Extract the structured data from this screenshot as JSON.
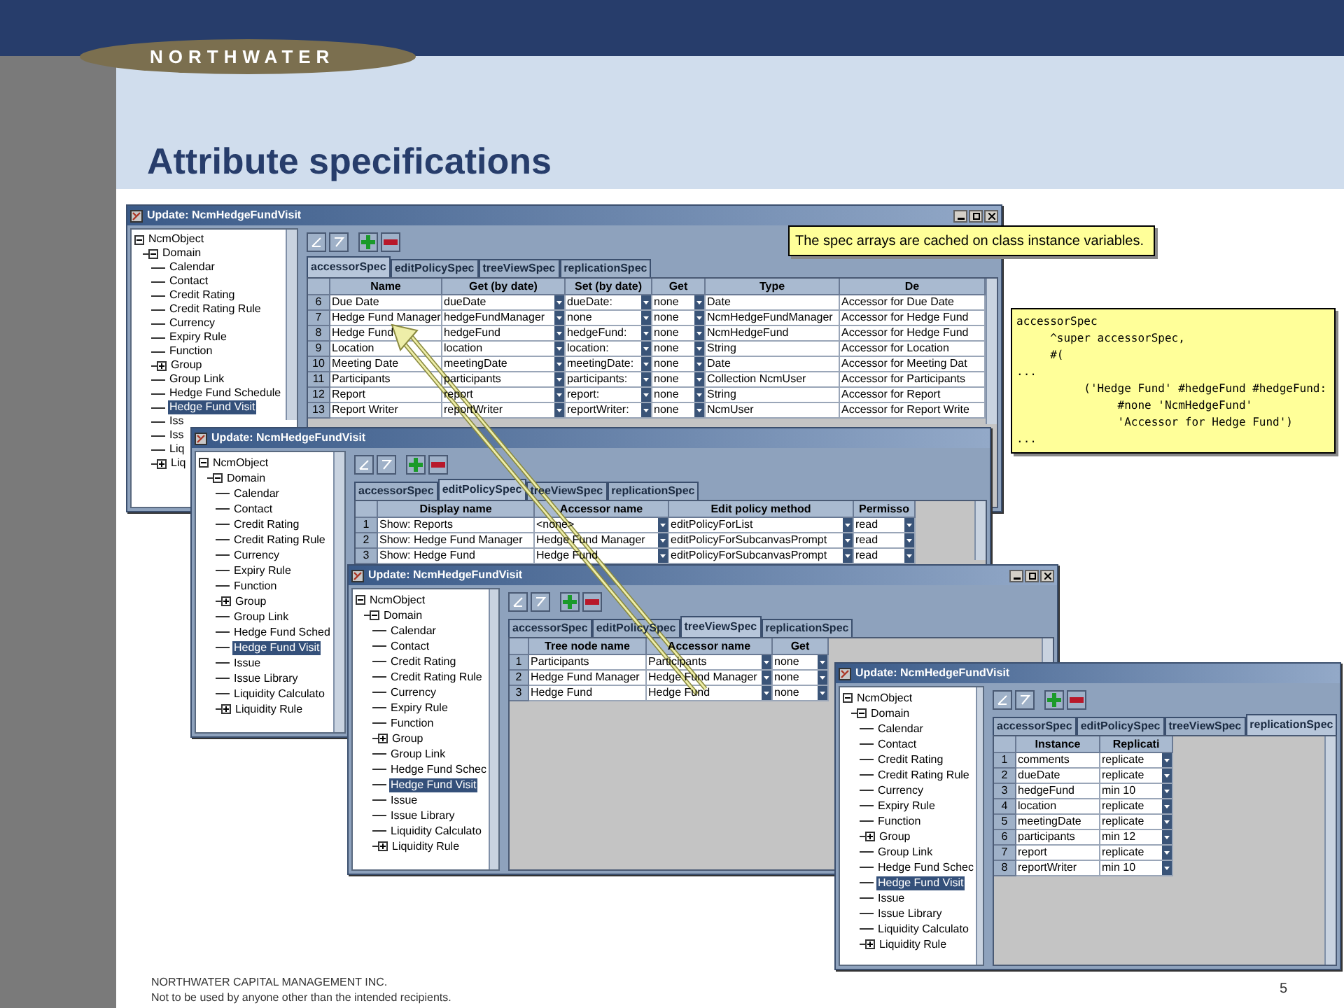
{
  "header": {
    "logo": "NORTHWATER",
    "title": "Attribute specifications"
  },
  "note": "The spec arrays are cached on class instance variables.",
  "code": [
    "accessorSpec",
    "     ^super accessorSpec,",
    "     #(",
    "...",
    "          ('Hedge Fund' #hedgeFund #hedgeFund:",
    "               #none 'NcmHedgeFund'",
    "               'Accessor for Hedge Fund')",
    "..."
  ],
  "windows": [
    {
      "title": "Update: NcmHedgeFundVisit",
      "title_buttons": true,
      "tree": {
        "label": "NcmObject",
        "kind": "node",
        "expanded": true,
        "selected": false,
        "children": [
          {
            "label": "Domain",
            "kind": "node",
            "expanded": true,
            "selected": false,
            "children": [
              {
                "label": "Calendar",
                "kind": "leaf",
                "selected": false
              },
              {
                "label": "Contact",
                "kind": "leaf",
                "selected": false
              },
              {
                "label": "Credit Rating",
                "kind": "leaf",
                "selected": false
              },
              {
                "label": "Credit Rating Rule",
                "kind": "leaf",
                "selected": false
              },
              {
                "label": "Currency",
                "kind": "leaf",
                "selected": false
              },
              {
                "label": "Expiry Rule",
                "kind": "leaf",
                "selected": false
              },
              {
                "label": "Function",
                "kind": "leaf",
                "selected": false
              },
              {
                "label": "Group",
                "kind": "node",
                "expanded": false,
                "selected": false
              },
              {
                "label": "Group Link",
                "kind": "leaf",
                "selected": false
              },
              {
                "label": "Hedge Fund Schedule",
                "kind": "leaf",
                "selected": false
              },
              {
                "label": "Hedge Fund Visit",
                "kind": "leaf",
                "selected": true
              },
              {
                "label": "Iss",
                "kind": "leaf",
                "selected": false
              },
              {
                "label": "Iss",
                "kind": "leaf",
                "selected": false
              },
              {
                "label": "Liq",
                "kind": "leaf",
                "selected": false
              },
              {
                "label": "Liq",
                "kind": "node",
                "expanded": false,
                "selected": false
              }
            ]
          }
        ]
      },
      "tabs": [
        {
          "label": "accessorSpec",
          "selected": true
        },
        {
          "label": "editPolicySpec",
          "selected": false
        },
        {
          "label": "treeViewSpec",
          "selected": false
        },
        {
          "label": "replicationSpec",
          "selected": false
        }
      ],
      "table": {
        "columns": [
          {
            "label": "Name",
            "dropdown": false
          },
          {
            "label": "Get (by date)",
            "dropdown": true
          },
          {
            "label": "Set (by date)",
            "dropdown": true
          },
          {
            "label": "Get",
            "dropdown": true
          },
          {
            "label": "Type",
            "dropdown": false
          },
          {
            "label": "De",
            "dropdown": false
          }
        ],
        "rows": [
          {
            "number": "6",
            "cells": [
              "Due Date",
              "dueDate",
              "dueDate:",
              "none",
              "Date",
              "Accessor for Due Date"
            ]
          },
          {
            "number": "7",
            "cells": [
              "Hedge Fund Manager",
              "hedgeFundManager",
              "none",
              "none",
              "NcmHedgeFundManager",
              "Accessor for Hedge Fund"
            ]
          },
          {
            "number": "8",
            "cells": [
              "Hedge Fund",
              "hedgeFund",
              "hedgeFund:",
              "none",
              "NcmHedgeFund",
              "Accessor for Hedge Fund"
            ]
          },
          {
            "number": "9",
            "cells": [
              "Location",
              "location",
              "location:",
              "none",
              "String",
              "Accessor for Location"
            ]
          },
          {
            "number": "10",
            "cells": [
              "Meeting Date",
              "meetingDate",
              "meetingDate:",
              "none",
              "Date",
              "Accessor for Meeting Dat"
            ]
          },
          {
            "number": "11",
            "cells": [
              "Participants",
              "participants",
              "participants:",
              "none",
              "Collection NcmUser",
              "Accessor for Participants"
            ]
          },
          {
            "number": "12",
            "cells": [
              "Report",
              "report",
              "report:",
              "none",
              "String",
              "Accessor for Report"
            ]
          },
          {
            "number": "13",
            "cells": [
              "Report Writer",
              "reportWriter",
              "reportWriter:",
              "none",
              "NcmUser",
              "Accessor for Report Write"
            ]
          }
        ]
      }
    },
    {
      "title": "Update: NcmHedgeFundVisit",
      "title_buttons": false,
      "tree": {
        "label": "NcmObject",
        "kind": "node",
        "expanded": true,
        "selected": false,
        "children": [
          {
            "label": "Domain",
            "kind": "node",
            "expanded": true,
            "selected": false,
            "children": [
              {
                "label": "Calendar",
                "kind": "leaf",
                "selected": false
              },
              {
                "label": "Contact",
                "kind": "leaf",
                "selected": false
              },
              {
                "label": "Credit Rating",
                "kind": "leaf",
                "selected": false
              },
              {
                "label": "Credit Rating Rule",
                "kind": "leaf",
                "selected": false
              },
              {
                "label": "Currency",
                "kind": "leaf",
                "selected": false
              },
              {
                "label": "Expiry Rule",
                "kind": "leaf",
                "selected": false
              },
              {
                "label": "Function",
                "kind": "leaf",
                "selected": false
              },
              {
                "label": "Group",
                "kind": "node",
                "expanded": false,
                "selected": false
              },
              {
                "label": "Group Link",
                "kind": "leaf",
                "selected": false
              },
              {
                "label": "Hedge Fund Sched",
                "kind": "leaf",
                "selected": false
              },
              {
                "label": "Hedge Fund Visit",
                "kind": "leaf",
                "selected": true
              },
              {
                "label": "Issue",
                "kind": "leaf",
                "selected": false
              },
              {
                "label": "Issue Library",
                "kind": "leaf",
                "selected": false
              },
              {
                "label": "Liquidity Calculato",
                "kind": "leaf",
                "selected": false
              },
              {
                "label": "Liquidity Rule",
                "kind": "node",
                "expanded": false,
                "selected": false
              }
            ]
          }
        ]
      },
      "tabs": [
        {
          "label": "accessorSpec",
          "selected": false
        },
        {
          "label": "editPolicySpec",
          "selected": true
        },
        {
          "label": "treeViewSpec",
          "selected": false
        },
        {
          "label": "replicationSpec",
          "selected": false
        }
      ],
      "table": {
        "columns": [
          {
            "label": "Display name",
            "dropdown": false
          },
          {
            "label": "Accessor name",
            "dropdown": true
          },
          {
            "label": "Edit policy method",
            "dropdown": true
          },
          {
            "label": "Permisso",
            "dropdown": true
          }
        ],
        "rows": [
          {
            "number": "1",
            "cells": [
              "Show: Reports",
              "<none>",
              "editPolicyForList",
              "read"
            ]
          },
          {
            "number": "2",
            "cells": [
              "Show: Hedge Fund Manager",
              "Hedge Fund Manager",
              "editPolicyForSubcanvasPrompt",
              "read"
            ]
          },
          {
            "number": "3",
            "cells": [
              "Show: Hedge Fund",
              "Hedge Fund",
              "editPolicyForSubcanvasPrompt",
              "read"
            ]
          }
        ]
      }
    },
    {
      "title": "Update: NcmHedgeFundVisit",
      "title_buttons": true,
      "tree": {
        "label": "NcmObject",
        "kind": "node",
        "expanded": true,
        "selected": false,
        "children": [
          {
            "label": "Domain",
            "kind": "node",
            "expanded": true,
            "selected": false,
            "children": [
              {
                "label": "Calendar",
                "kind": "leaf",
                "selected": false
              },
              {
                "label": "Contact",
                "kind": "leaf",
                "selected": false
              },
              {
                "label": "Credit Rating",
                "kind": "leaf",
                "selected": false
              },
              {
                "label": "Credit Rating Rule",
                "kind": "leaf",
                "selected": false
              },
              {
                "label": "Currency",
                "kind": "leaf",
                "selected": false
              },
              {
                "label": "Expiry Rule",
                "kind": "leaf",
                "selected": false
              },
              {
                "label": "Function",
                "kind": "leaf",
                "selected": false
              },
              {
                "label": "Group",
                "kind": "node",
                "expanded": false,
                "selected": false
              },
              {
                "label": "Group Link",
                "kind": "leaf",
                "selected": false
              },
              {
                "label": "Hedge Fund Schec",
                "kind": "leaf",
                "selected": false
              },
              {
                "label": "Hedge Fund Visit",
                "kind": "leaf",
                "selected": true
              },
              {
                "label": "Issue",
                "kind": "leaf",
                "selected": false
              },
              {
                "label": "Issue Library",
                "kind": "leaf",
                "selected": false
              },
              {
                "label": "Liquidity Calculato",
                "kind": "leaf",
                "selected": false
              },
              {
                "label": "Liquidity Rule",
                "kind": "node",
                "expanded": false,
                "selected": false
              }
            ]
          }
        ]
      },
      "tabs": [
        {
          "label": "accessorSpec",
          "selected": false
        },
        {
          "label": "editPolicySpec",
          "selected": false
        },
        {
          "label": "treeViewSpec",
          "selected": true
        },
        {
          "label": "replicationSpec",
          "selected": false
        }
      ],
      "table": {
        "columns": [
          {
            "label": "Tree node name",
            "dropdown": false
          },
          {
            "label": "Accessor name",
            "dropdown": true
          },
          {
            "label": "Get",
            "dropdown": true
          }
        ],
        "rows": [
          {
            "number": "1",
            "cells": [
              "Participants",
              "Participants",
              "none"
            ]
          },
          {
            "number": "2",
            "cells": [
              "Hedge Fund Manager",
              "Hedge Fund Manager",
              "none"
            ]
          },
          {
            "number": "3",
            "cells": [
              "Hedge Fund",
              "Hedge Fund",
              "none"
            ]
          }
        ]
      }
    },
    {
      "title": "Update: NcmHedgeFundVisit",
      "title_buttons": false,
      "tree": {
        "label": "NcmObject",
        "kind": "node",
        "expanded": true,
        "selected": false,
        "children": [
          {
            "label": "Domain",
            "kind": "node",
            "expanded": true,
            "selected": false,
            "children": [
              {
                "label": "Calendar",
                "kind": "leaf",
                "selected": false
              },
              {
                "label": "Contact",
                "kind": "leaf",
                "selected": false
              },
              {
                "label": "Credit Rating",
                "kind": "leaf",
                "selected": false
              },
              {
                "label": "Credit Rating Rule",
                "kind": "leaf",
                "selected": false
              },
              {
                "label": "Currency",
                "kind": "leaf",
                "selected": false
              },
              {
                "label": "Expiry Rule",
                "kind": "leaf",
                "selected": false
              },
              {
                "label": "Function",
                "kind": "leaf",
                "selected": false
              },
              {
                "label": "Group",
                "kind": "node",
                "expanded": false,
                "selected": false
              },
              {
                "label": "Group Link",
                "kind": "leaf",
                "selected": false
              },
              {
                "label": "Hedge Fund Schec",
                "kind": "leaf",
                "selected": false
              },
              {
                "label": "Hedge Fund Visit",
                "kind": "leaf",
                "selected": true
              },
              {
                "label": "Issue",
                "kind": "leaf",
                "selected": false
              },
              {
                "label": "Issue Library",
                "kind": "leaf",
                "selected": false
              },
              {
                "label": "Liquidity Calculato",
                "kind": "leaf",
                "selected": false
              },
              {
                "label": "Liquidity Rule",
                "kind": "node",
                "expanded": false,
                "selected": false
              }
            ]
          }
        ]
      },
      "tabs": [
        {
          "label": "accessorSpec",
          "selected": false
        },
        {
          "label": "editPolicySpec",
          "selected": false
        },
        {
          "label": "treeViewSpec",
          "selected": false
        },
        {
          "label": "replicationSpec",
          "selected": true
        }
      ],
      "table": {
        "columns": [
          {
            "label": "Instance",
            "dropdown": false
          },
          {
            "label": "Replicati",
            "dropdown": true
          }
        ],
        "rows": [
          {
            "number": "1",
            "cells": [
              "comments",
              "replicate"
            ]
          },
          {
            "number": "2",
            "cells": [
              "dueDate",
              "replicate"
            ]
          },
          {
            "number": "3",
            "cells": [
              "hedgeFund",
              "min 10"
            ]
          },
          {
            "number": "4",
            "cells": [
              "location",
              "replicate"
            ]
          },
          {
            "number": "5",
            "cells": [
              "meetingDate",
              "replicate"
            ]
          },
          {
            "number": "6",
            "cells": [
              "participants",
              "min 12"
            ]
          },
          {
            "number": "7",
            "cells": [
              "report",
              "replicate"
            ]
          },
          {
            "number": "8",
            "cells": [
              "reportWriter",
              "min 10"
            ]
          }
        ]
      }
    }
  ],
  "footer": {
    "company": "NORTHWATER CAPITAL MANAGEMENT INC.",
    "disclaimer": "Not to be used by anyone other than the intended recipients.",
    "page": "5"
  }
}
